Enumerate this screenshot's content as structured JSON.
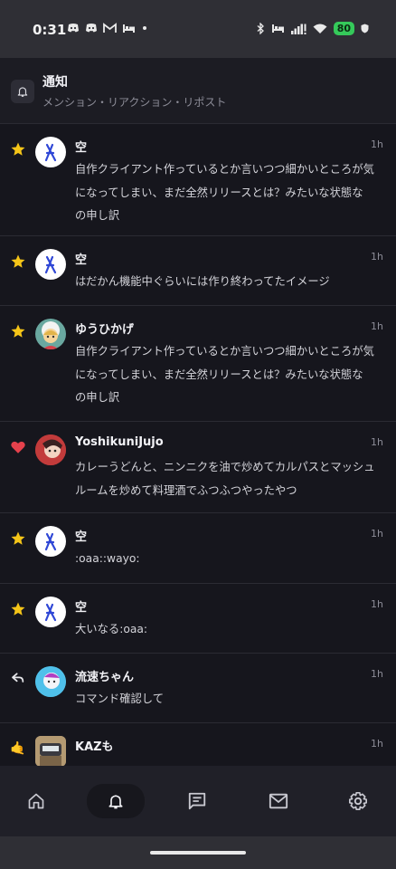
{
  "status_bar": {
    "time": "0:31",
    "battery": "80",
    "left_icons": [
      "discord-icon",
      "discord-icon",
      "gmail-icon",
      "bed-icon",
      "dot-icon"
    ],
    "right_icons": [
      "bluetooth-icon",
      "bed-icon",
      "signal-icon",
      "wifi-icon",
      "battery-icon"
    ]
  },
  "header": {
    "title": "通知",
    "subtitle": "メンション・リアクション・リポスト"
  },
  "colors": {
    "background": "#16161d",
    "header": "#1c1c23",
    "divider": "#2b2b33",
    "star": "#f5c518",
    "heart": "#e5414c",
    "muted": "#8d8d98",
    "battery": "#35c95a"
  },
  "notifications": [
    {
      "reaction": "star",
      "reaction_icon": "star-icon",
      "avatar": "sora-avatar",
      "name": "空",
      "time": "1h",
      "text": "自作クライアント作っているとか言いつつ細かいところが気\nになってしまい、まだ全然リリースとは？みたいな状態な\nの申し訳"
    },
    {
      "reaction": "star",
      "reaction_icon": "star-icon",
      "avatar": "sora-avatar",
      "name": "空",
      "time": "1h",
      "text": "はだかん機能中ぐらいには作り終わってたイメージ"
    },
    {
      "reaction": "star",
      "reaction_icon": "star-icon",
      "avatar": "yuuhikage-avatar",
      "name": "ゆうひかげ",
      "time": "1h",
      "text": "自作クライアント作っているとか言いつつ細かいところが気\nになってしまい、まだ全然リリースとは？みたいな状態な\nの申し訳"
    },
    {
      "reaction": "heart",
      "reaction_icon": "heart-icon",
      "avatar": "yoshikuni-avatar",
      "name": "YoshikuniJujo",
      "time": "1h",
      "text": "カレーうどんと、ニンニクを油で炒めてカルパスとマッシュ\nルームを炒めて料理酒でふつふつやったやつ"
    },
    {
      "reaction": "star",
      "reaction_icon": "star-icon",
      "avatar": "sora-avatar",
      "name": "空",
      "time": "1h",
      "text": ":oaa::wayo:"
    },
    {
      "reaction": "star",
      "reaction_icon": "star-icon",
      "avatar": "sora-avatar",
      "name": "空",
      "time": "1h",
      "text": "大いなる:oaa:"
    },
    {
      "reaction": "renote",
      "reaction_icon": "reply-arrow-icon",
      "avatar": "ryuusoku-avatar",
      "name": "流速ちゃん",
      "time": "1h",
      "text": "コマンド確認して"
    },
    {
      "reaction": "call-me",
      "reaction_icon": "call-me-hand-icon",
      "avatar": "kaz-avatar",
      "name": "KAZも",
      "time": "1h",
      "text": ""
    }
  ],
  "bottom_nav": [
    {
      "name": "home",
      "icon": "home-icon",
      "active": false
    },
    {
      "name": "notifications",
      "icon": "bell-icon",
      "active": true
    },
    {
      "name": "chat",
      "icon": "chat-icon",
      "active": false
    },
    {
      "name": "mail",
      "icon": "mail-icon",
      "active": false
    },
    {
      "name": "settings",
      "icon": "gear-icon",
      "active": false
    }
  ]
}
